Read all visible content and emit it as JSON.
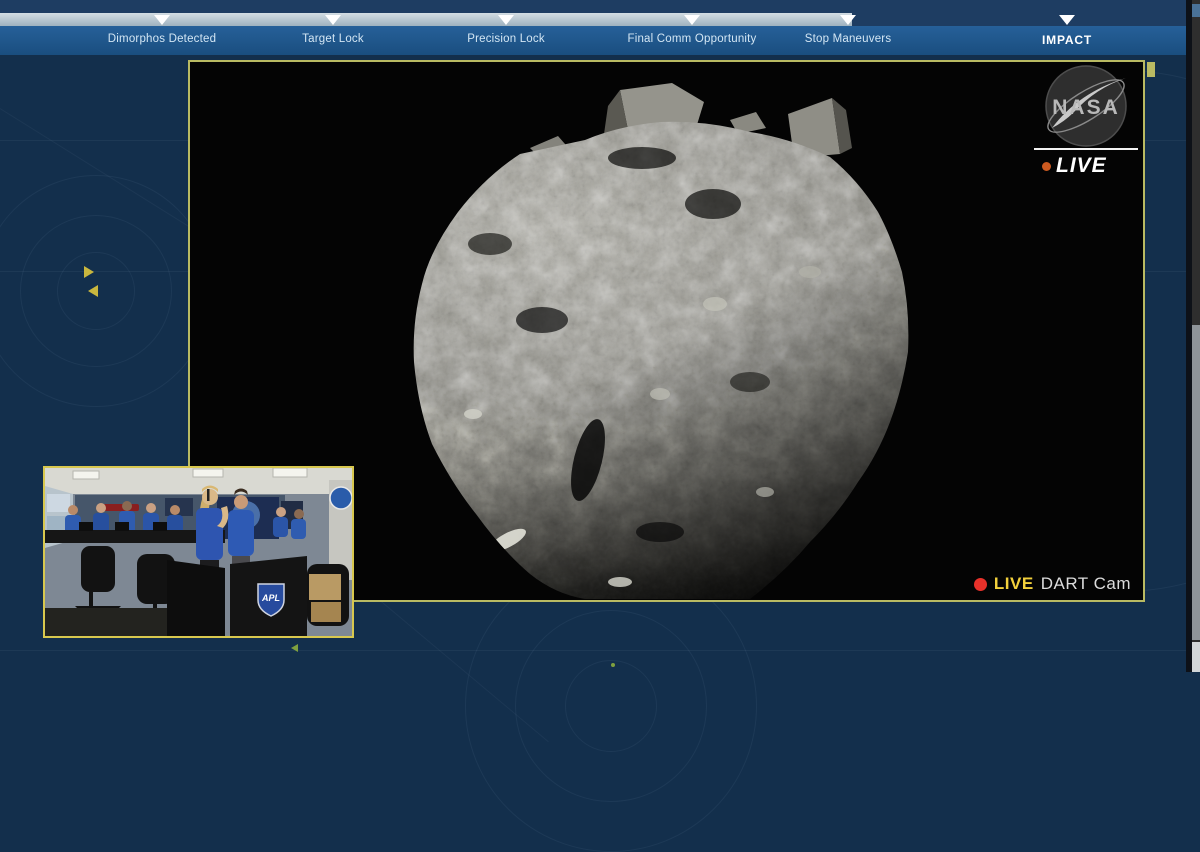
{
  "timeline": {
    "progress_fraction": 0.71,
    "stations": [
      {
        "label": "Dimorphos Detected"
      },
      {
        "label": "Target Lock"
      },
      {
        "label": "Precision Lock"
      },
      {
        "label": "Final Comm Opportunity"
      },
      {
        "label": "Stop Maneuvers"
      },
      {
        "label": "IMPACT"
      }
    ]
  },
  "broadcast_bug": {
    "nasa_logo_text": "NASA",
    "live_label": "LIVE"
  },
  "camera_caption": {
    "live_label": "LIVE",
    "camera_label": "DART Cam"
  },
  "pip": {
    "apl_logo_text": "APL"
  },
  "colors": {
    "background_navy": "#132f4c",
    "timeline_bar_blue": "#1f5a8c",
    "timeline_track_gray": "#a9bac6",
    "frame_yellow": "#b9ba62",
    "pip_border_yellow": "#d8c84e",
    "live_text_yellow": "#f2d03c",
    "record_red": "#e8312a",
    "live_dot_orange": "#cc5a20"
  }
}
